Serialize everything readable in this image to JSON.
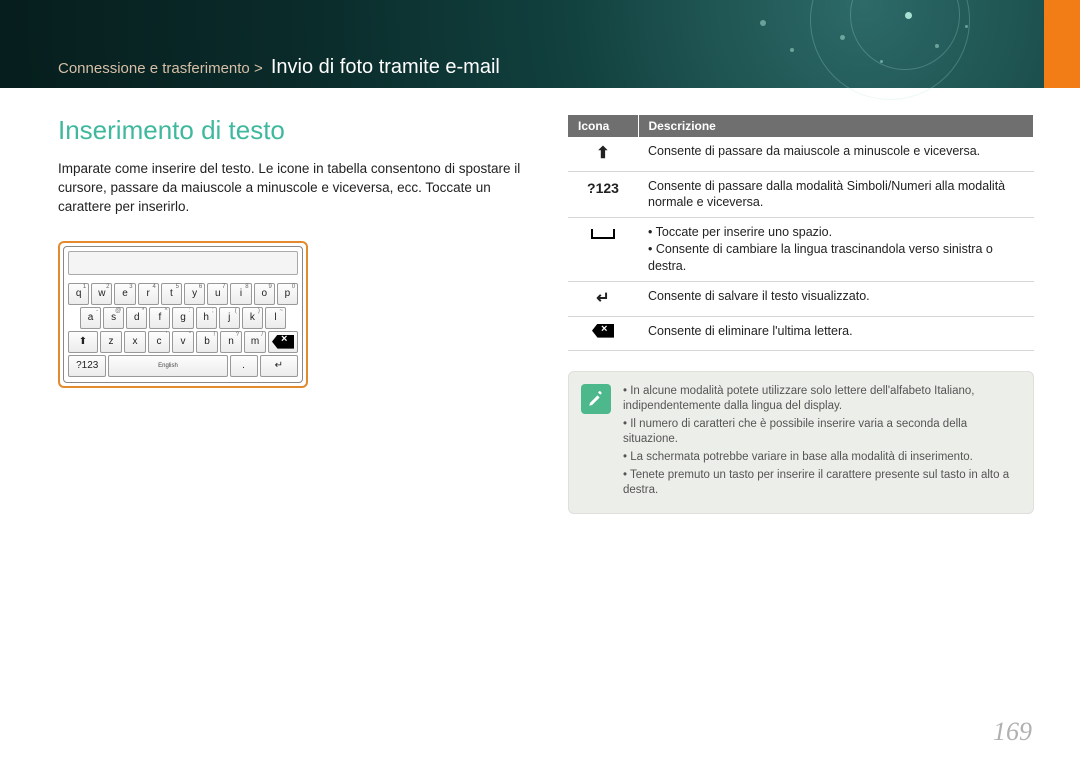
{
  "breadcrumb": {
    "path": "Connessione e trasferimento >",
    "title": "Invio di foto tramite e-mail"
  },
  "section_title": "Inserimento di testo",
  "intro": "Imparate come inserire del testo. Le icone in tabella consentono di spostare il cursore, passare da maiuscole a minuscole e viceversa, ecc. Toccate un carattere per inserirlo.",
  "keyboard": {
    "row1": [
      {
        "k": "q",
        "s": "1"
      },
      {
        "k": "w",
        "s": "2"
      },
      {
        "k": "e",
        "s": "3"
      },
      {
        "k": "r",
        "s": "4"
      },
      {
        "k": "t",
        "s": "5"
      },
      {
        "k": "y",
        "s": "6"
      },
      {
        "k": "u",
        "s": "7"
      },
      {
        "k": "i",
        "s": "8"
      },
      {
        "k": "o",
        "s": "9"
      },
      {
        "k": "p",
        "s": "0"
      }
    ],
    "row2": [
      {
        "k": "a",
        "s": "-"
      },
      {
        "k": "s",
        "s": "@"
      },
      {
        "k": "d",
        "s": "*"
      },
      {
        "k": "f",
        "s": "^"
      },
      {
        "k": "g",
        "s": ":"
      },
      {
        "k": "h",
        "s": ";"
      },
      {
        "k": "j",
        "s": "("
      },
      {
        "k": "k",
        "s": ")"
      },
      {
        "k": "l",
        "s": "~"
      }
    ],
    "row3": [
      {
        "k": "z",
        "s": ""
      },
      {
        "k": "x",
        "s": ""
      },
      {
        "k": "c",
        "s": "'"
      },
      {
        "k": "v",
        "s": "\""
      },
      {
        "k": "b",
        "s": "!"
      },
      {
        "k": "n",
        "s": "?"
      },
      {
        "k": "m",
        "s": "/"
      }
    ],
    "shift": "⇧",
    "backspace_glyph": "⌫",
    "mode_key": "?123",
    "lang_label": "English",
    "period": ".",
    "enter": "↵"
  },
  "table": {
    "head_icon": "Icona",
    "head_desc": "Descrizione",
    "rows": [
      {
        "id": "shift",
        "desc": "Consente di passare da maiuscole a minuscole e viceversa."
      },
      {
        "id": "sym123",
        "label": "?123",
        "desc": "Consente di passare dalla modalità Simboli/Numeri alla modalità normale e viceversa."
      },
      {
        "id": "space",
        "desc_list": [
          "Toccate per inserire uno spazio.",
          "Consente di cambiare la lingua trascinandola verso sinistra o destra."
        ]
      },
      {
        "id": "enter",
        "desc": "Consente di salvare il testo visualizzato."
      },
      {
        "id": "backspace",
        "desc": "Consente di eliminare l'ultima lettera."
      }
    ]
  },
  "note": {
    "items": [
      "In alcune modalità potete utilizzare solo lettere dell'alfabeto Italiano, indipendentemente dalla lingua del display.",
      "Il numero di caratteri che è possibile inserire varia a seconda della situazione.",
      "La schermata potrebbe variare in base alla modalità di inserimento.",
      "Tenete premuto un tasto per inserire il carattere presente sul tasto in alto a destra."
    ]
  },
  "page_number": "169"
}
